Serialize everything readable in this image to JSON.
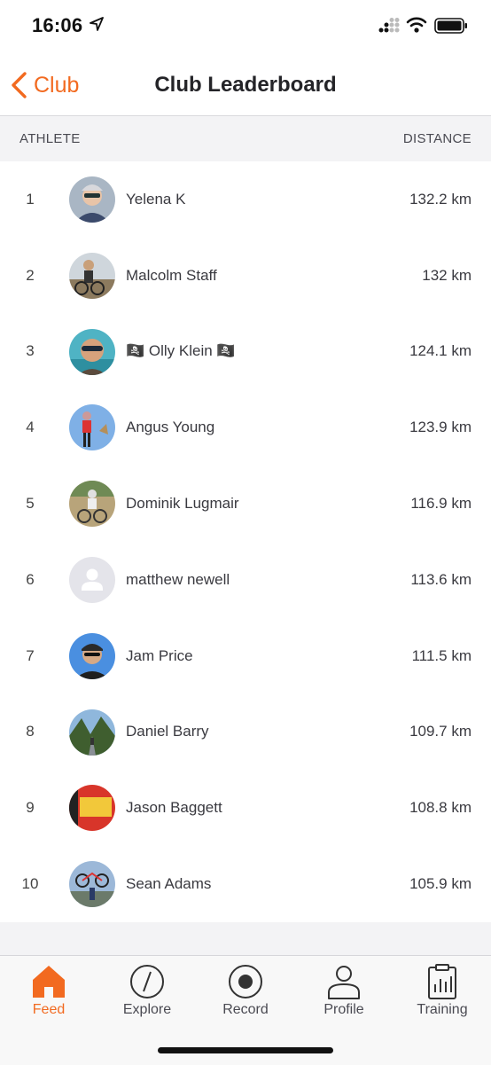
{
  "status_bar": {
    "time": "16:06"
  },
  "nav": {
    "back_label": "Club",
    "title": "Club Leaderboard"
  },
  "columns": {
    "athlete": "ATHLETE",
    "distance": "DISTANCE"
  },
  "leaderboard": [
    {
      "rank": "1",
      "name": "Yelena K",
      "distance": "132.2 km"
    },
    {
      "rank": "2",
      "name": "Malcolm Staff",
      "distance": "132 km"
    },
    {
      "rank": "3",
      "name": "🏴‍☠️ Olly Klein 🏴‍☠️",
      "distance": "124.1 km"
    },
    {
      "rank": "4",
      "name": "Angus Young",
      "distance": "123.9 km"
    },
    {
      "rank": "5",
      "name": "Dominik Lugmair",
      "distance": "116.9 km"
    },
    {
      "rank": "6",
      "name": "matthew newell",
      "distance": "113.6 km"
    },
    {
      "rank": "7",
      "name": "Jam Price",
      "distance": "111.5 km"
    },
    {
      "rank": "8",
      "name": "Daniel Barry",
      "distance": "109.7 km"
    },
    {
      "rank": "9",
      "name": "Jason Baggett",
      "distance": "108.8 km"
    },
    {
      "rank": "10",
      "name": "Sean Adams",
      "distance": "105.9 km"
    }
  ],
  "tabs": [
    {
      "label": "Feed",
      "icon": "home-icon",
      "active": true
    },
    {
      "label": "Explore",
      "icon": "compass-icon",
      "active": false
    },
    {
      "label": "Record",
      "icon": "record-icon",
      "active": false
    },
    {
      "label": "Profile",
      "icon": "profile-icon",
      "active": false
    },
    {
      "label": "Training",
      "icon": "training-icon",
      "active": false
    }
  ],
  "colors": {
    "accent": "#f26a20",
    "text": "#242428",
    "header_bg": "#f3f3f5"
  }
}
